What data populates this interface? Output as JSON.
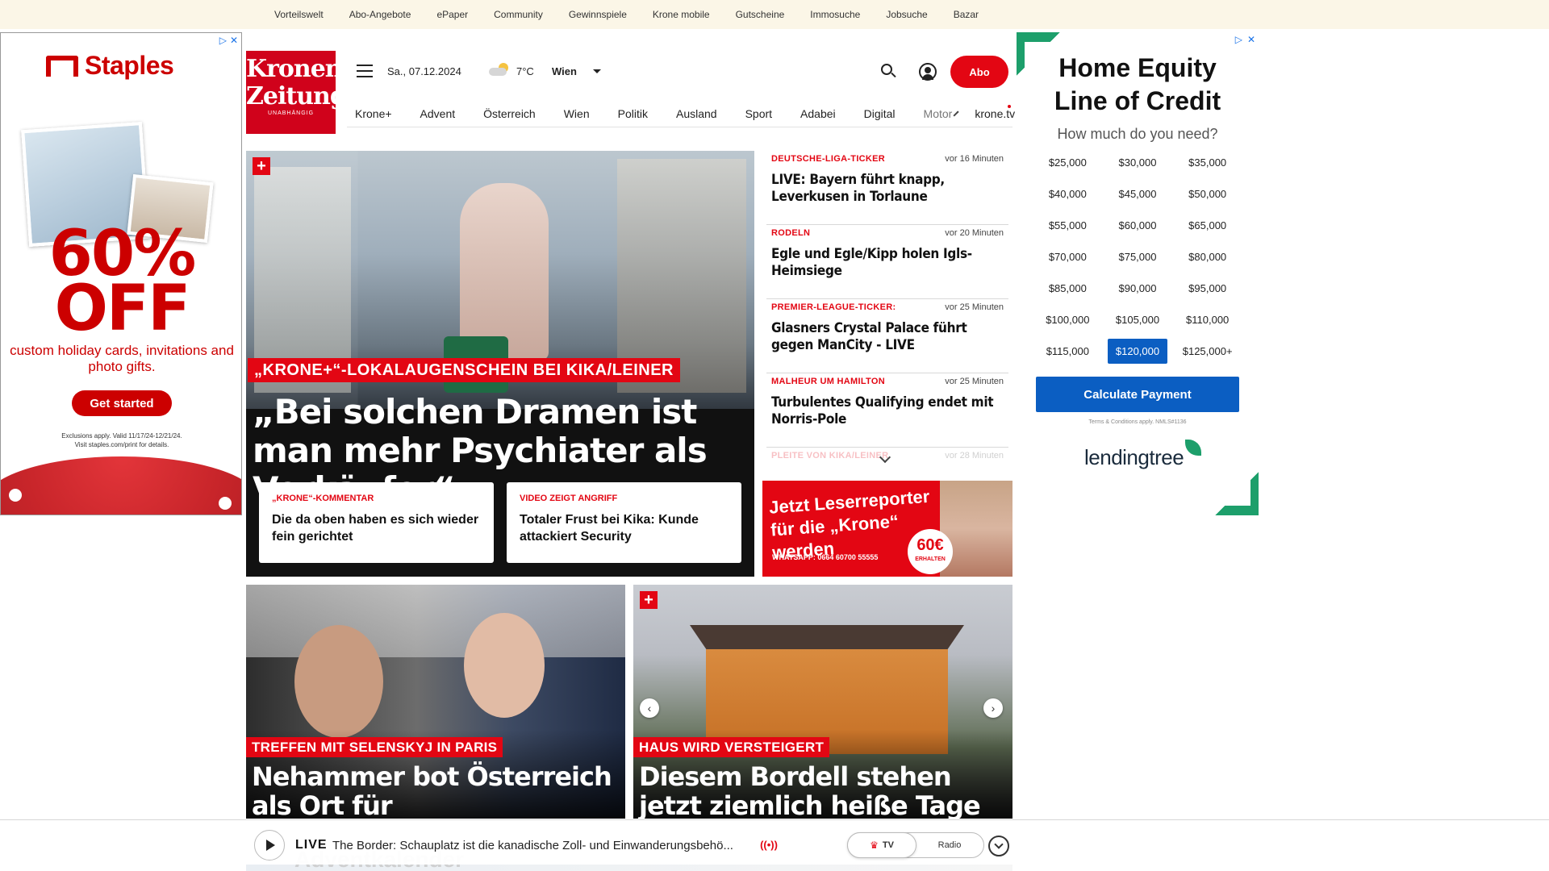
{
  "topbar": {
    "items": [
      "Vorteilswelt",
      "Abo-Angebote",
      "ePaper",
      "Community",
      "Gewinnspiele",
      "Krone mobile",
      "Gutscheine",
      "Immosuche",
      "Jobsuche",
      "Bazar"
    ]
  },
  "ad_left": {
    "brand": "Staples",
    "offer_line1": "60%",
    "offer_line2": "OFF",
    "subtext": "custom holiday cards, invitations and photo gifts.",
    "cta": "Get started",
    "fine_print_1": "Exclusions apply. Valid 11/17/24-12/21/24.",
    "fine_print_2": "Visit staples.com/print for details.",
    "controls_info": "▷",
    "controls_close": "✕"
  },
  "header": {
    "logo_line1": "Kronen",
    "logo_line2": "Zeitung",
    "logo_sub": "UNABHÄNGIG",
    "date": "Sa., 07.12.2024",
    "temperature": "7°C",
    "city": "Wien",
    "abo_label": "Abo"
  },
  "nav": {
    "items": [
      "Krone+",
      "Advent",
      "Österreich",
      "Wien",
      "Politik",
      "Ausland",
      "Sport",
      "Adabei",
      "Digital"
    ],
    "faded_item": "Motor",
    "tv_link": "krone.tv"
  },
  "hero": {
    "kicker": "„KRONE+“-LOKALAUGENSCHEIN BEI KIKA/LEINER",
    "title": "„Bei solchen Dramen ist man mehr Psychiater als Verkäufer“",
    "plus_badge": "+",
    "cards": [
      {
        "kicker": "„KRONE“-KOMMENTAR",
        "title": "Die da oben haben es sich wieder fein gerichtet"
      },
      {
        "kicker": "VIDEO ZEIGT ANGRIFF",
        "title": "Totaler Frust bei Kika: Kunde attackiert Security"
      }
    ]
  },
  "ticker": {
    "items": [
      {
        "kicker": "DEUTSCHE-LIGA-TICKER",
        "time": "vor 16 Minuten",
        "title": "LIVE: Bayern führt knapp, Leverkusen in Torlaune"
      },
      {
        "kicker": "RODELN",
        "time": "vor 20 Minuten",
        "title": "Egle und Egle/Kipp holen Igls-Heimsiege"
      },
      {
        "kicker": "PREMIER-LEAGUE-TICKER:",
        "time": "vor 25 Minuten",
        "title": "Glasners Crystal Palace führt gegen ManCity - LIVE"
      },
      {
        "kicker": "MALHEUR UM HAMILTON",
        "time": "vor 25 Minuten",
        "title": "Turbulentes Qualifying endet mit Norris-Pole"
      },
      {
        "kicker": "PLEITE VON KIKA/LEINER",
        "time": "vor 28 Minuten",
        "title": ""
      }
    ]
  },
  "reporter_banner": {
    "text_line1": "Jetzt Leserreporter",
    "text_line2": "für die „Krone“ werden",
    "phone": "WHATSAPP: 0664 60700 55555",
    "badge_amount": "60€",
    "badge_label": "ERHALTEN"
  },
  "ad_right": {
    "title_line1": "Home Equity",
    "title_line2": "Line of Credit",
    "subtitle": "How much do you need?",
    "amounts": [
      "$25,000",
      "$30,000",
      "$35,000",
      "$40,000",
      "$45,000",
      "$50,000",
      "$55,000",
      "$60,000",
      "$65,000",
      "$70,000",
      "$75,000",
      "$80,000",
      "$85,000",
      "$90,000",
      "$95,000",
      "$100,000",
      "$105,000",
      "$110,000",
      "$115,000",
      "$120,000",
      "$125,000+"
    ],
    "selected_amount": "$120,000",
    "cta": "Calculate Payment",
    "terms": "Terms & Conditions apply. NMLS#1136",
    "brand": "lendingtree",
    "controls_info": "▷",
    "controls_close": "✕"
  },
  "articles": [
    {
      "kicker": "TREFFEN MIT SELENSKYJ IN PARIS",
      "title": "Nehammer bot Österreich als Ort für Friedensgespräche an"
    },
    {
      "kicker": "HAUS WIRD VERSTEIGERT",
      "title": "Diesem Bordell stehen jetzt ziemlich heiße Tage bevor"
    }
  ],
  "player": {
    "live_label": "LIVE",
    "live_text": "The Border: Schauplatz ist die kanadische Zoll- und Einwanderungsbehö...",
    "live_icon": "((•))",
    "mode_tv": "TV",
    "mode_radio": "Radio",
    "advent_peek": "Adventkalender"
  },
  "colors": {
    "krone_red": "#e30613",
    "topbar_bg": "#fbf6e7",
    "lendingtree_blue": "#0b5ec2",
    "lendingtree_green": "#1d9f6b",
    "staples_red": "#cc0000"
  }
}
